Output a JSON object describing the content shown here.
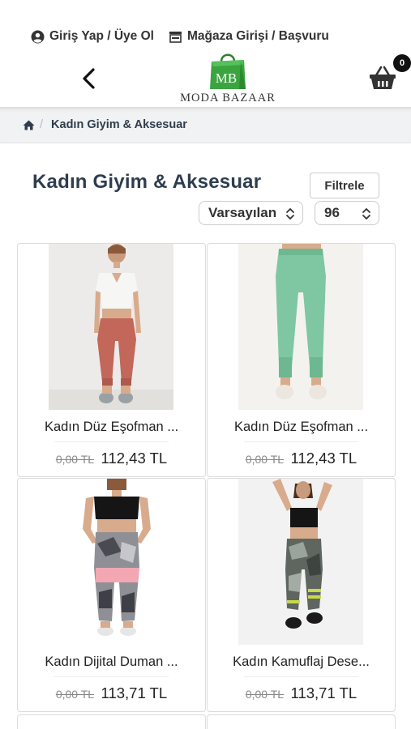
{
  "topbar": {
    "login_label": "Giriş Yap / Üye Ol",
    "store_label": "Mağaza Girişi / Başvuru"
  },
  "header": {
    "logo_text": "MODA BAZAAR",
    "logo_bag_letters": "MB",
    "cart_count": "0"
  },
  "breadcrumb": {
    "current": "Kadın Giyim & Aksesuar"
  },
  "page": {
    "title": "Kadın Giyim & Aksesuar",
    "filter_label": "Filtrele",
    "sort_value": "Varsayılan",
    "per_page_value": "96"
  },
  "products": [
    {
      "name": "Kadın Düz Eşofman ...",
      "old_price": "0,00 TL",
      "price": "112,43 TL"
    },
    {
      "name": "Kadın Düz Eşofman ...",
      "old_price": "0,00 TL",
      "price": "112,43 TL"
    },
    {
      "name": "Kadın Dijital Duman ...",
      "old_price": "0,00 TL",
      "price": "113,71 TL"
    },
    {
      "name": "Kadın Kamuflaj Dese...",
      "old_price": "0,00 TL",
      "price": "113,71 TL"
    }
  ],
  "colors": {
    "title": "#2e3d4f",
    "logo_green": "#3aa53f",
    "breadcrumb_bg": "#f1f2f3"
  }
}
